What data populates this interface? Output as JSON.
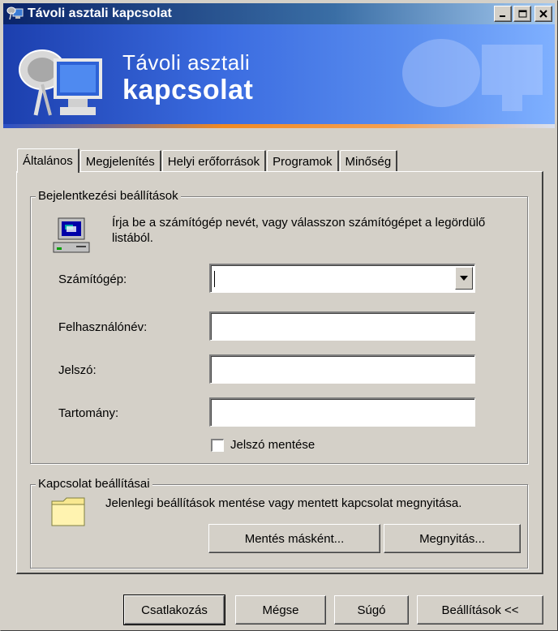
{
  "window": {
    "title": "Távoli asztali kapcsolat"
  },
  "banner": {
    "line1": "Távoli asztali",
    "line2": "kapcsolat"
  },
  "tabs": [
    {
      "label": "Általános"
    },
    {
      "label": "Megjelenítés"
    },
    {
      "label": "Helyi erőforrások"
    },
    {
      "label": "Programok"
    },
    {
      "label": "Minőség"
    }
  ],
  "logon": {
    "legend": "Bejelentkezési beállítások",
    "description": "Írja be a számítógép nevét, vagy válasszon számítógépet a legördülő listából.",
    "computer_label": "Számítógép:",
    "computer_value": "",
    "username_label": "Felhasználónév:",
    "username_value": "",
    "password_label": "Jelszó:",
    "password_value": "",
    "domain_label": "Tartomány:",
    "domain_value": "",
    "save_password_label": "Jelszó mentése",
    "save_password_checked": false
  },
  "connection": {
    "legend": "Kapcsolat beállításai",
    "description": "Jelenlegi beállítások mentése vagy mentett kapcsolat megnyitása.",
    "save_as_label": "Mentés másként...",
    "open_label": "Megnyitás..."
  },
  "footer": {
    "connect_label": "Csatlakozás",
    "cancel_label": "Mégse",
    "help_label": "Súgó",
    "options_label": "Beállítások <<"
  },
  "colors": {
    "face": "#d4d0c8",
    "title_active": "#0a246a",
    "banner_blue": "#3b6ce0",
    "banner_orange": "#f08a24"
  }
}
